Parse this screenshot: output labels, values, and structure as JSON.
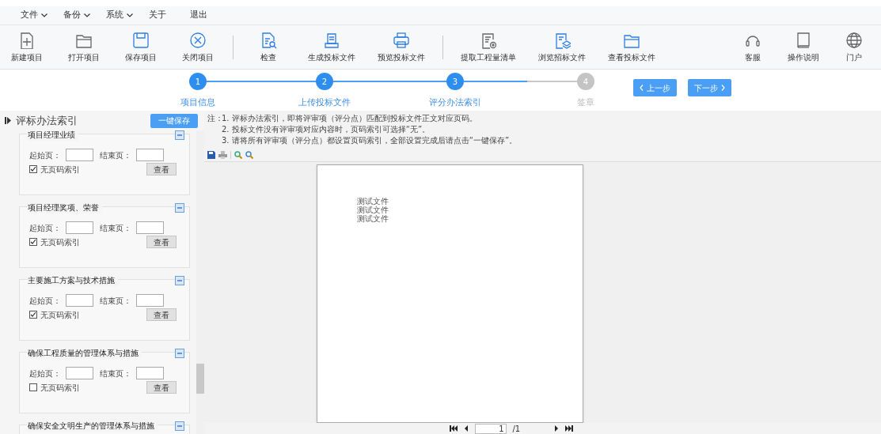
{
  "menu": [
    {
      "label": "文件",
      "dropdown": true
    },
    {
      "label": "备份",
      "dropdown": true
    },
    {
      "label": "系统",
      "dropdown": true
    },
    {
      "label": "关于",
      "dropdown": false
    },
    {
      "label": "退出",
      "dropdown": false
    }
  ],
  "toolbar": {
    "groups": [
      [
        {
          "label": "新建项目",
          "highlighted": false
        },
        {
          "label": "打开项目",
          "highlighted": false
        },
        {
          "label": "保存项目",
          "highlighted": true
        },
        {
          "label": "关闭项目",
          "highlighted": true
        }
      ],
      [
        {
          "label": "检查",
          "highlighted": true
        },
        {
          "label": "生成投标文件",
          "highlighted": true
        },
        {
          "label": "预览投标文件",
          "highlighted": true
        }
      ],
      [
        {
          "label": "提取工程量清单",
          "highlighted": false
        },
        {
          "label": "浏览招标文件",
          "highlighted": true
        },
        {
          "label": "查看投标文件",
          "highlighted": true
        }
      ]
    ],
    "right": [
      {
        "label": "客服",
        "highlighted": false
      },
      {
        "label": "操作说明",
        "highlighted": false
      },
      {
        "label": "门户",
        "highlighted": false
      }
    ]
  },
  "steps": [
    {
      "number": "1",
      "label": "项目信息",
      "done": true
    },
    {
      "number": "2",
      "label": "上传投标文件",
      "done": true
    },
    {
      "number": "3",
      "label": "评分办法索引",
      "done": true
    },
    {
      "number": "4",
      "label": "签章",
      "done": false
    }
  ],
  "nav_buttons": {
    "prev": "上一步",
    "next": "下一步"
  },
  "sidebar": {
    "title": "评标办法索引",
    "save_button": "一键保存",
    "sections": [
      {
        "title": "项目经理业绩",
        "start_label": "起始页：",
        "end_label": "结束页：",
        "checkbox_label": "无页码索引",
        "checked": true,
        "view_button": "查看"
      },
      {
        "title": "项目经理奖项、荣誉",
        "start_label": "起始页：",
        "end_label": "结束页：",
        "checkbox_label": "无页码索引",
        "checked": true,
        "view_button": "查看"
      },
      {
        "title": "主要施工方案与技术措施",
        "start_label": "起始页：",
        "end_label": "结束页：",
        "checkbox_label": "无页码索引",
        "checked": true,
        "view_button": "查看"
      },
      {
        "title": "确保工程质量的管理体系与措施",
        "start_label": "起始页：",
        "end_label": "结束页：",
        "checkbox_label": "无页码索引",
        "checked": false,
        "view_button": "查看"
      },
      {
        "title": "确保安全文明生产的管理体系与措施"
      }
    ]
  },
  "notes": {
    "prefix": "注：",
    "lines": [
      "1. 评标办法索引，即将评审项（评分点）匹配到投标文件正文对应页码。",
      "2. 投标文件没有评审项对应内容时，页码索引可选择“无”。",
      "3. 请将所有评审项（评分点）都设置页码索引，全部设置完成后请点击“一键保存”。"
    ]
  },
  "document": {
    "lines": [
      "测试文件",
      "测试文件",
      "测试文件"
    ]
  },
  "pager": {
    "page": "1",
    "total": "/1"
  }
}
